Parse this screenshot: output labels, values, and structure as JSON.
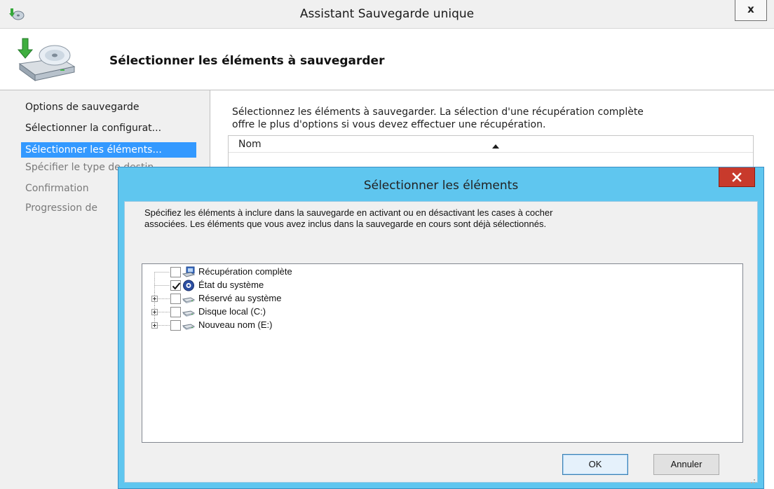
{
  "wizard": {
    "title": "Assistant Sauvegarde unique",
    "close_label": "x",
    "header_title": "Sélectionner les éléments à sauvegarder",
    "icons": {
      "app": "backup-app-icon",
      "header": "backup-drive-icon"
    },
    "nav": [
      {
        "label": "Options de sauvegarde",
        "state": "normal"
      },
      {
        "label": "Sélectionner la configurat...",
        "state": "normal"
      },
      {
        "label": "Sélectionner les éléments...",
        "state": "selected"
      },
      {
        "label": "Spécifier le type de destin...",
        "state": "disabled"
      },
      {
        "label": "Confirmation",
        "state": "disabled"
      },
      {
        "label": "Progression de",
        "state": "disabled"
      }
    ],
    "description_line1": "Sélectionnez les éléments à sauvegarder. La sélection d'une récupération complète",
    "description_line2": "offre le plus d'options si vous devez effectuer une récupération.",
    "list": {
      "column_name": "Nom",
      "sort": "ascending"
    }
  },
  "dialog": {
    "title": "Sélectionner les éléments",
    "description_line1": "Spécifiez les éléments à inclure dans la sauvegarde en activant ou en désactivant les cases à cocher",
    "description_line2": "associées. Les éléments que vous avez inclus dans la sauvegarde en cours sont déjà sélectionnés.",
    "tree": [
      {
        "label": "Récupération complète",
        "checked": false,
        "expandable": false,
        "icon": "full-recovery-icon"
      },
      {
        "label": "État du système",
        "checked": true,
        "expandable": false,
        "icon": "system-state-icon"
      },
      {
        "label": "Réservé au système",
        "checked": false,
        "expandable": true,
        "icon": "drive-icon"
      },
      {
        "label": "Disque local (C:)",
        "checked": false,
        "expandable": true,
        "icon": "drive-icon"
      },
      {
        "label": "Nouveau nom (E:)",
        "checked": false,
        "expandable": true,
        "icon": "drive-icon"
      }
    ],
    "ok_label": "OK",
    "cancel_label": "Annuler"
  },
  "colors": {
    "selection": "#3399ff",
    "dialog_frame": "#5fc6ef",
    "close_button": "#c83a2c"
  }
}
